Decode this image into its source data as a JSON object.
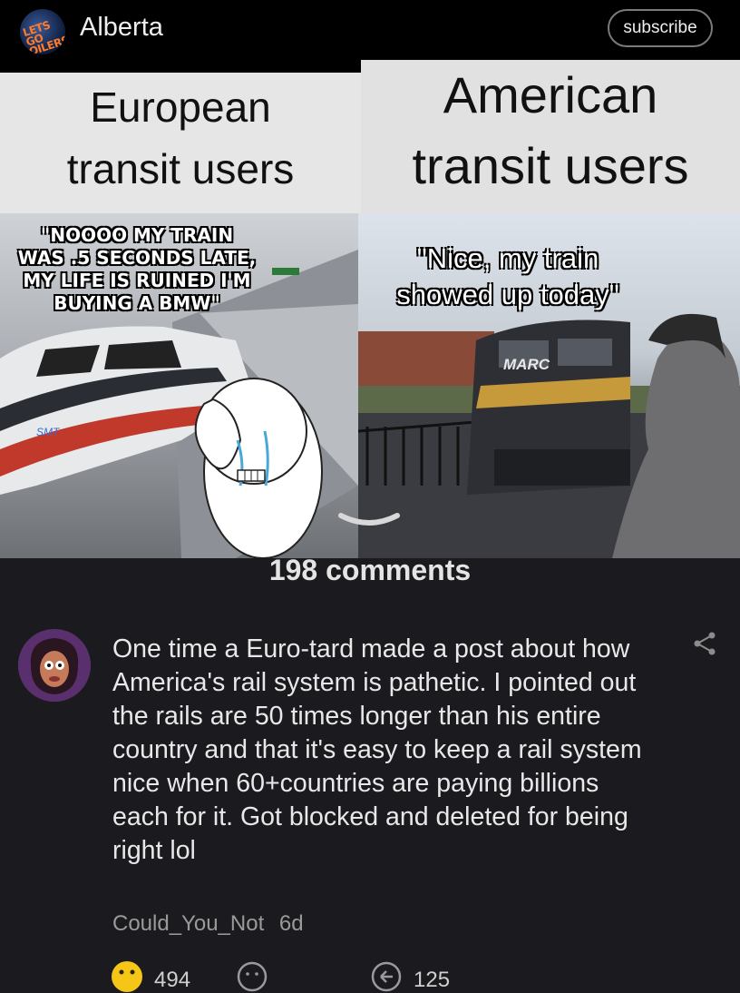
{
  "header": {
    "subreddit_name": "Alberta",
    "subreddit_avatar_text": "LETS GO OILERS",
    "subscribe_label": "subscribe"
  },
  "meme": {
    "left_caption_line1": "European",
    "left_caption_line2": "transit users",
    "right_caption_line1": "American",
    "right_caption_line2": "transit users",
    "left_quote_line1": "\"NOOOO MY TRAIN",
    "left_quote_line2": "WAS .5 SECONDS LATE,",
    "left_quote_line3": "MY LIFE IS RUINED I'M",
    "left_quote_line4": "BUYING A BMW\"",
    "right_quote_line1": "\"Nice, my train",
    "right_quote_line2": "showed up today\"",
    "train_logo": "MARC",
    "left_train_logo": "SMT"
  },
  "comments": {
    "count_label": "198 comments"
  },
  "comment": {
    "text": "One time a Euro-tard made a post about how America's rail system is pathetic. I pointed out the rails are 50 times longer than his entire country and that it's easy to keep a rail system nice when 60+countries are paying billions each for it. Got blocked and deleted for being right lol",
    "author": "Could_You_Not",
    "age": "6d",
    "upvotes": "494",
    "replies": "125"
  },
  "icons": {
    "share": "share-icon",
    "collapse": "chevron-down-icon",
    "upvote": "emoji-upvote-icon",
    "react": "smiley-icon",
    "reply": "reply-icon"
  },
  "colors": {
    "background": "#1b1b1f",
    "topbar": "#000000",
    "upvote_yellow": "#f5c518"
  }
}
